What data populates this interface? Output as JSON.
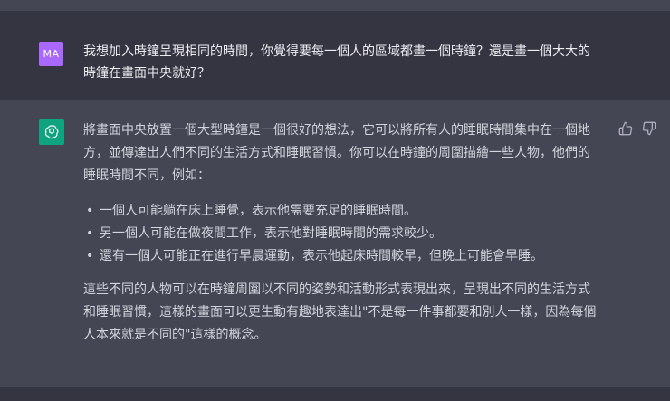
{
  "user_message": {
    "avatar_initials": "MA",
    "text": "我想加入時鐘呈現相同的時間，你覺得要每一個人的區域都畫一個時鐘？還是畫一個大大的\n時鐘在畫面中央就好？"
  },
  "assistant_message": {
    "intro": "將畫面中央放置一個大型時鐘是一個很好的想法，它可以將所有人的睡眠時間集中在一個地\n方，並傳達出人們不同的生活方式和睡眠習慣。你可以在時鐘的周圍描繪一些人物，他們的\n睡眠時間不同，例如：",
    "bullets": [
      "一個人可能躺在床上睡覺，表示他需要充足的睡眠時間。",
      "另一個人可能在做夜間工作，表示他對睡眠時間的需求較少。",
      "還有一個人可能正在進行早晨運動，表示他起床時間較早，但晚上可能會早睡。"
    ],
    "conclusion": "這些不同的人物可以在時鐘周圍以不同的姿勢和活動形式表現出來，呈現出不同的生活方式\n和睡眠習慣，這樣的畫面可以更生動有趣地表達出\"不是每一件事都要和別人一樣，因為每個\n人本來就是不同的\"這樣的概念。"
  },
  "colors": {
    "user_bg": "#343541",
    "assistant_bg": "#444654",
    "user_avatar": "#ab68ff",
    "bot_avatar": "#10a37f"
  },
  "icons": {
    "bot_avatar": "openai-logo-icon",
    "like": "thumbs-up-icon",
    "dislike": "thumbs-down-icon"
  }
}
